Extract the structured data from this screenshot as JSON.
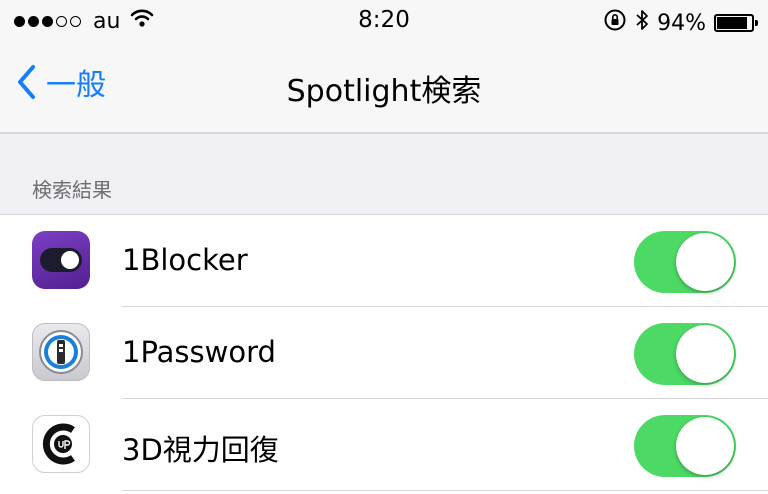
{
  "status_bar": {
    "carrier": "au",
    "time": "8:20",
    "battery": "94%",
    "battery_level": 0.94,
    "signal_bars_filled": 3,
    "signal_bars_total": 5
  },
  "nav": {
    "back_label": "一般",
    "title": "Spotlight検索"
  },
  "section": {
    "header": "検索結果"
  },
  "rows": [
    {
      "label": "1Blocker",
      "icon": "1blocker-app-icon",
      "toggle_on": true
    },
    {
      "label": "1Password",
      "icon": "1password-app-icon",
      "toggle_on": true
    },
    {
      "label": "3D視力回復",
      "icon": "3d-vision-app-icon",
      "toggle_on": true
    }
  ],
  "colors": {
    "accent": "#157efb",
    "toggle_on": "#4cd964",
    "background": "#efeff4"
  }
}
